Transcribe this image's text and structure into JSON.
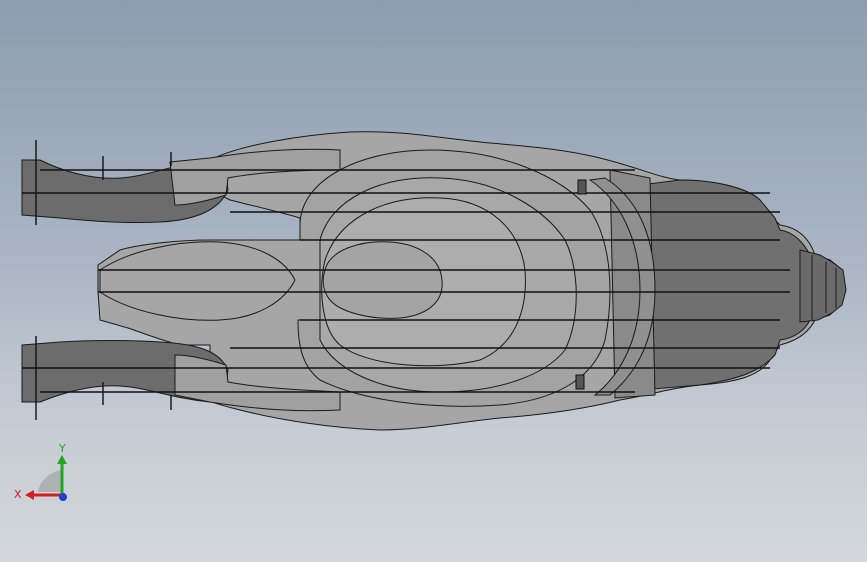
{
  "viewport": {
    "background_top": "#8d9cb0",
    "background_bottom": "#d3d7dc"
  },
  "model": {
    "fill_light": "#b3b3b3",
    "fill_mid": "#989898",
    "fill_dark": "#7a7a7a",
    "fill_darker": "#666666",
    "stroke": "#1a1a1a"
  },
  "triad": {
    "x_label": "X",
    "y_label": "Y",
    "x_color": "#d21f1f",
    "y_color": "#1fa51f",
    "z_color": "#1f3fd2"
  }
}
